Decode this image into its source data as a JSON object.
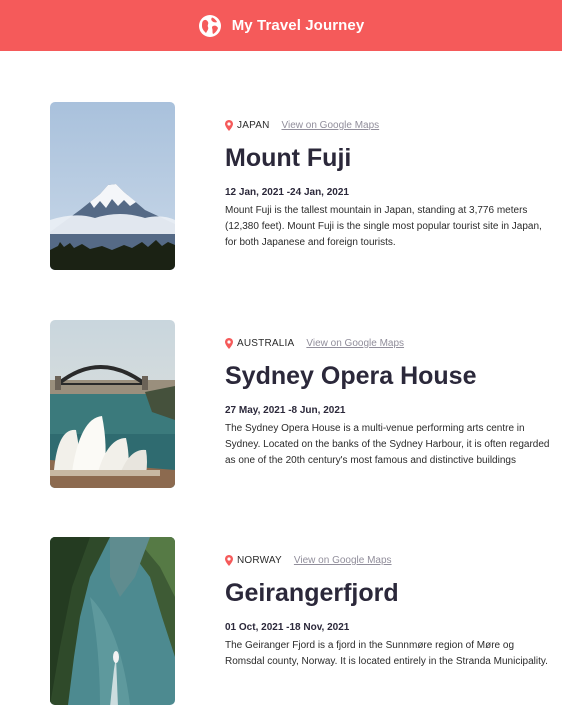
{
  "header": {
    "title": "My Travel Journey",
    "icon": "globe-icon",
    "background": "#f55a5a"
  },
  "entries": [
    {
      "location": "JAPAN",
      "maps_label": "View on Google Maps",
      "title": "Mount Fuji",
      "dates": "12 Jan, 2021 -24 Jan, 2021",
      "description": "Mount Fuji is the tallest mountain in Japan, standing at 3,776 meters (12,380 feet). Mount Fuji is the single most popular tourist site in Japan, for both Japanese and foreign tourists."
    },
    {
      "location": "AUSTRALIA",
      "maps_label": "View on Google Maps",
      "title": "Sydney Opera House",
      "dates": "27 May, 2021 -8 Jun, 2021",
      "description": "The Sydney Opera House is a multi-venue performing arts centre in Sydney. Located on the banks of the Sydney Harbour, it is often regarded as one of the 20th century's most famous and distinctive buildings"
    },
    {
      "location": "NORWAY",
      "maps_label": "View on Google Maps",
      "title": "Geirangerfjord",
      "dates": "01 Oct, 2021 -18 Nov, 2021",
      "description": "The Geiranger Fjord is a fjord in the Sunnmøre region of Møre og Romsdal county, Norway. It is located entirely in the Stranda Municipality."
    }
  ],
  "icons": {
    "location": "location-pin-icon"
  },
  "colors": {
    "accent": "#f55a5a",
    "link": "#918e9b",
    "heading": "#2b283a"
  }
}
